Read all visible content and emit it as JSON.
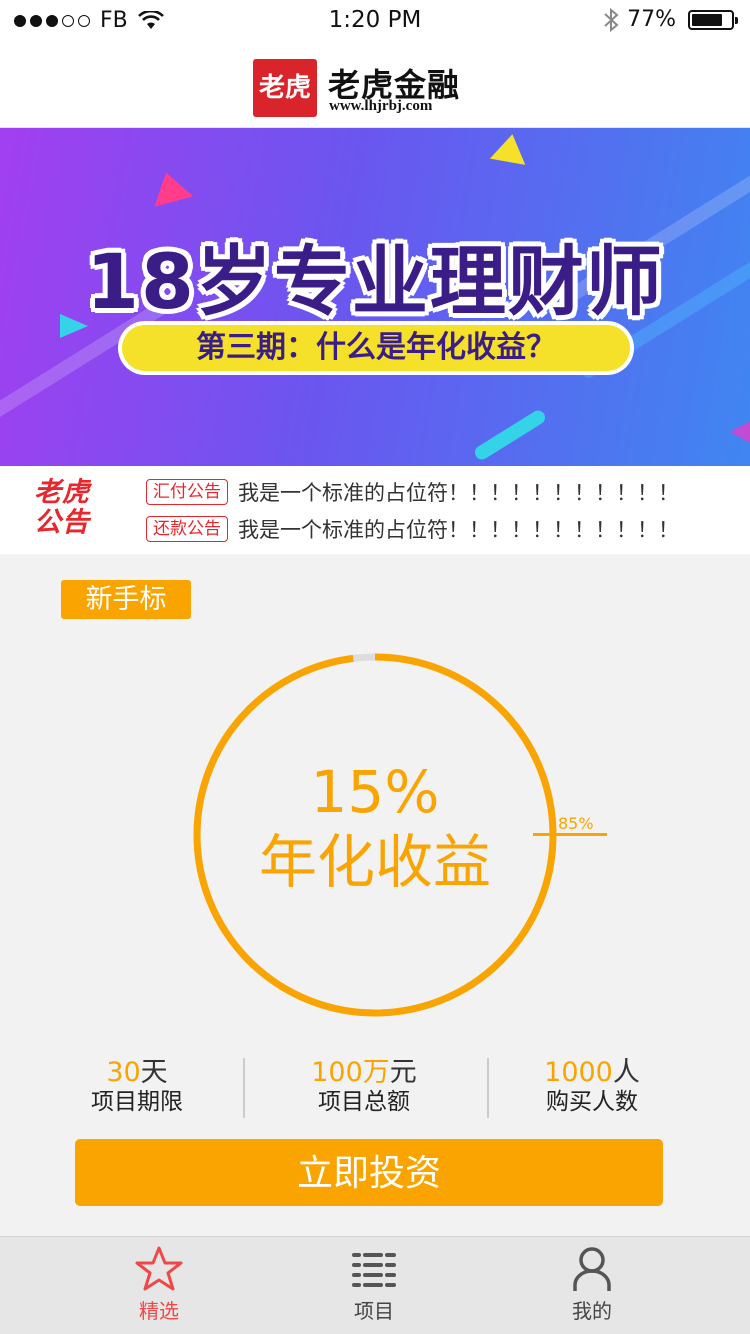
{
  "status_bar": {
    "carrier": "FB",
    "time": "1:20 PM",
    "battery": "77%"
  },
  "header": {
    "logo_mark": "老虎",
    "brand_name": "老虎金融",
    "brand_url": "www.lhjrbj.com"
  },
  "banner": {
    "title": "18岁专业理财师",
    "subtitle": "第三期：什么是年化收益？"
  },
  "notice": {
    "logo_line1": "老虎",
    "logo_line2": "公告",
    "items": [
      {
        "tag": "汇付公告",
        "text": "我是一个标准的占位符！！！！！！！！！！！"
      },
      {
        "tag": "还款公告",
        "text": "我是一个标准的占位符！！！！！！！！！！！"
      }
    ]
  },
  "product": {
    "badge": "新手标",
    "rate": "15%",
    "rate_label": "年化收益",
    "progress_label": "85%",
    "progress": 0.98,
    "stats": [
      {
        "value": "30",
        "unit": "天",
        "label": "项目期限"
      },
      {
        "value": "100万",
        "unit": "元",
        "label": "项目总额"
      },
      {
        "value": "1000",
        "unit": "人",
        "label": "购买人数"
      }
    ],
    "invest_button": "立即投资"
  },
  "tabs": [
    {
      "label": "精选",
      "icon": "star-icon",
      "active": true
    },
    {
      "label": "项目",
      "icon": "list-icon",
      "active": false
    },
    {
      "label": "我的",
      "icon": "person-icon",
      "active": false
    }
  ],
  "colors": {
    "accent": "#f9a400",
    "notice_red": "#e8262d",
    "tab_active": "#f04848",
    "tab_inactive": "#555555"
  }
}
